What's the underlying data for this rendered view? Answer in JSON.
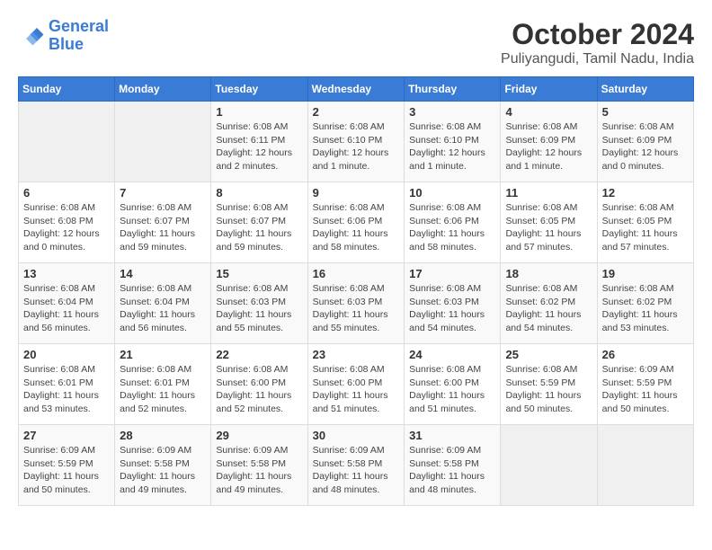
{
  "logo": {
    "line1": "General",
    "line2": "Blue"
  },
  "title": "October 2024",
  "location": "Puliyangudi, Tamil Nadu, India",
  "headers": [
    "Sunday",
    "Monday",
    "Tuesday",
    "Wednesday",
    "Thursday",
    "Friday",
    "Saturday"
  ],
  "weeks": [
    [
      {
        "day": "",
        "info": ""
      },
      {
        "day": "",
        "info": ""
      },
      {
        "day": "1",
        "info": "Sunrise: 6:08 AM\nSunset: 6:11 PM\nDaylight: 12 hours\nand 2 minutes."
      },
      {
        "day": "2",
        "info": "Sunrise: 6:08 AM\nSunset: 6:10 PM\nDaylight: 12 hours\nand 1 minute."
      },
      {
        "day": "3",
        "info": "Sunrise: 6:08 AM\nSunset: 6:10 PM\nDaylight: 12 hours\nand 1 minute."
      },
      {
        "day": "4",
        "info": "Sunrise: 6:08 AM\nSunset: 6:09 PM\nDaylight: 12 hours\nand 1 minute."
      },
      {
        "day": "5",
        "info": "Sunrise: 6:08 AM\nSunset: 6:09 PM\nDaylight: 12 hours\nand 0 minutes."
      }
    ],
    [
      {
        "day": "6",
        "info": "Sunrise: 6:08 AM\nSunset: 6:08 PM\nDaylight: 12 hours\nand 0 minutes."
      },
      {
        "day": "7",
        "info": "Sunrise: 6:08 AM\nSunset: 6:07 PM\nDaylight: 11 hours\nand 59 minutes."
      },
      {
        "day": "8",
        "info": "Sunrise: 6:08 AM\nSunset: 6:07 PM\nDaylight: 11 hours\nand 59 minutes."
      },
      {
        "day": "9",
        "info": "Sunrise: 6:08 AM\nSunset: 6:06 PM\nDaylight: 11 hours\nand 58 minutes."
      },
      {
        "day": "10",
        "info": "Sunrise: 6:08 AM\nSunset: 6:06 PM\nDaylight: 11 hours\nand 58 minutes."
      },
      {
        "day": "11",
        "info": "Sunrise: 6:08 AM\nSunset: 6:05 PM\nDaylight: 11 hours\nand 57 minutes."
      },
      {
        "day": "12",
        "info": "Sunrise: 6:08 AM\nSunset: 6:05 PM\nDaylight: 11 hours\nand 57 minutes."
      }
    ],
    [
      {
        "day": "13",
        "info": "Sunrise: 6:08 AM\nSunset: 6:04 PM\nDaylight: 11 hours\nand 56 minutes."
      },
      {
        "day": "14",
        "info": "Sunrise: 6:08 AM\nSunset: 6:04 PM\nDaylight: 11 hours\nand 56 minutes."
      },
      {
        "day": "15",
        "info": "Sunrise: 6:08 AM\nSunset: 6:03 PM\nDaylight: 11 hours\nand 55 minutes."
      },
      {
        "day": "16",
        "info": "Sunrise: 6:08 AM\nSunset: 6:03 PM\nDaylight: 11 hours\nand 55 minutes."
      },
      {
        "day": "17",
        "info": "Sunrise: 6:08 AM\nSunset: 6:03 PM\nDaylight: 11 hours\nand 54 minutes."
      },
      {
        "day": "18",
        "info": "Sunrise: 6:08 AM\nSunset: 6:02 PM\nDaylight: 11 hours\nand 54 minutes."
      },
      {
        "day": "19",
        "info": "Sunrise: 6:08 AM\nSunset: 6:02 PM\nDaylight: 11 hours\nand 53 minutes."
      }
    ],
    [
      {
        "day": "20",
        "info": "Sunrise: 6:08 AM\nSunset: 6:01 PM\nDaylight: 11 hours\nand 53 minutes."
      },
      {
        "day": "21",
        "info": "Sunrise: 6:08 AM\nSunset: 6:01 PM\nDaylight: 11 hours\nand 52 minutes."
      },
      {
        "day": "22",
        "info": "Sunrise: 6:08 AM\nSunset: 6:00 PM\nDaylight: 11 hours\nand 52 minutes."
      },
      {
        "day": "23",
        "info": "Sunrise: 6:08 AM\nSunset: 6:00 PM\nDaylight: 11 hours\nand 51 minutes."
      },
      {
        "day": "24",
        "info": "Sunrise: 6:08 AM\nSunset: 6:00 PM\nDaylight: 11 hours\nand 51 minutes."
      },
      {
        "day": "25",
        "info": "Sunrise: 6:08 AM\nSunset: 5:59 PM\nDaylight: 11 hours\nand 50 minutes."
      },
      {
        "day": "26",
        "info": "Sunrise: 6:09 AM\nSunset: 5:59 PM\nDaylight: 11 hours\nand 50 minutes."
      }
    ],
    [
      {
        "day": "27",
        "info": "Sunrise: 6:09 AM\nSunset: 5:59 PM\nDaylight: 11 hours\nand 50 minutes."
      },
      {
        "day": "28",
        "info": "Sunrise: 6:09 AM\nSunset: 5:58 PM\nDaylight: 11 hours\nand 49 minutes."
      },
      {
        "day": "29",
        "info": "Sunrise: 6:09 AM\nSunset: 5:58 PM\nDaylight: 11 hours\nand 49 minutes."
      },
      {
        "day": "30",
        "info": "Sunrise: 6:09 AM\nSunset: 5:58 PM\nDaylight: 11 hours\nand 48 minutes."
      },
      {
        "day": "31",
        "info": "Sunrise: 6:09 AM\nSunset: 5:58 PM\nDaylight: 11 hours\nand 48 minutes."
      },
      {
        "day": "",
        "info": ""
      },
      {
        "day": "",
        "info": ""
      }
    ]
  ]
}
